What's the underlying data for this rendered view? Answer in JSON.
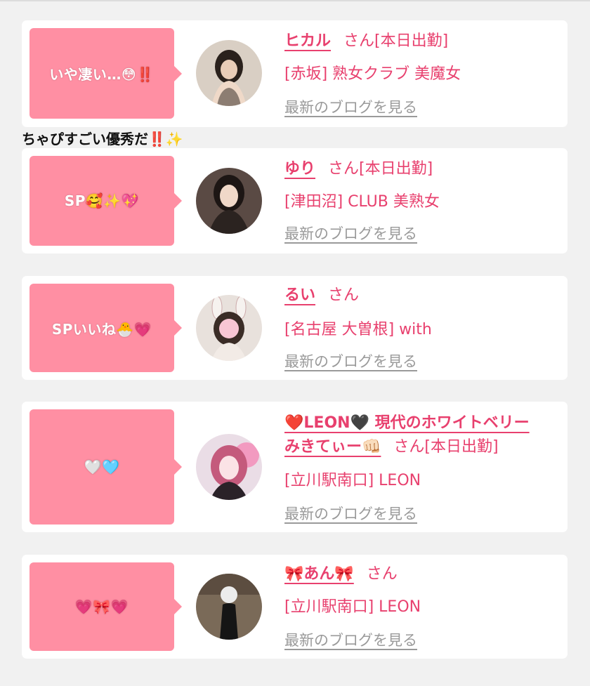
{
  "comment_between": "ちゃぴすごい優秀だ‼️✨",
  "cards": [
    {
      "bubble": "いや凄い…😳‼️",
      "name": "ヒカル",
      "san": "さん",
      "status": "[本日出勤]",
      "shop": "[赤坂] 熟女クラブ 美魔女",
      "blog": "最新のブログを見る"
    },
    {
      "bubble": "SP🥰✨💖",
      "name": "ゆり",
      "san": "さん",
      "status": "[本日出勤]",
      "shop": "[津田沼] CLUB 美熟女",
      "blog": "最新のブログを見る"
    },
    {
      "bubble": "SPいいね🐣💗",
      "name": "るい",
      "san": "さん",
      "status": "",
      "shop": "[名古屋 大曽根] with",
      "blog": "最新のブログを見る"
    },
    {
      "bubble": "🤍🩵",
      "name_line1": "❤️LEON🖤 現代のホワイトベリー",
      "name_line2": "みきてぃー👊🏻",
      "san": "さん",
      "status": "[本日出勤]",
      "shop": "[立川駅南口] LEON",
      "blog": "最新のブログを見る"
    },
    {
      "bubble": "💗🎀💗",
      "name": "🎀あん🎀",
      "san": "さん",
      "status": "",
      "shop": "[立川駅南口] LEON",
      "blog": "最新のブログを見る"
    }
  ]
}
